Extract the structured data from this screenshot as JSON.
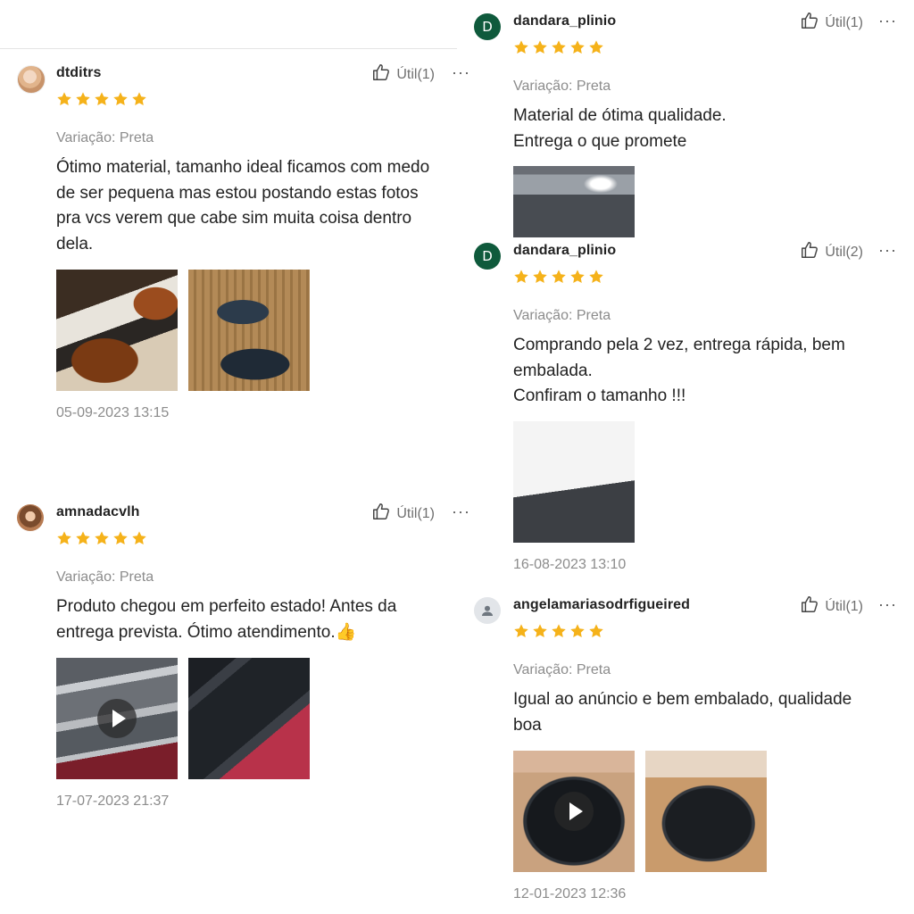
{
  "colors": {
    "star": "#f5b21a",
    "muted": "#8c8c8c",
    "avatar_d": "#0f5a3c"
  },
  "reviews": [
    {
      "username": "dtditrs",
      "avatar": "avatar-photo",
      "helpful": "Útil(1)",
      "rating": 5,
      "variation": "Variação: Preta",
      "text": "Ótimo material, tamanho ideal  ficamos com medo de ser pequena mas estou postando estas fotos pra vcs verem que cabe sim muita coisa dentro dela.",
      "photos": [
        "photo",
        "photo"
      ],
      "date": "05-09-2023 13:15"
    },
    {
      "username": "amnadacvlh",
      "avatar": "avatar-photo",
      "helpful": "Útil(1)",
      "rating": 5,
      "variation": "Variação: Preta",
      "text": "Produto chegou em perfeito estado! Antes da entrega prevista. Ótimo atendimento.👍",
      "photos": [
        "video",
        "photo"
      ],
      "date": "17-07-2023 21:37"
    },
    {
      "username": "dandara_plinio",
      "avatar_letter": "D",
      "helpful": "Útil(1)",
      "rating": 5,
      "variation": "Variação: Preta",
      "text_lines": [
        "Material de ótima qualidade.",
        "Entrega o que promete"
      ],
      "photos": [
        "photo"
      ]
    },
    {
      "username": "dandara_plinio",
      "avatar_letter": "D",
      "helpful": "Útil(2)",
      "rating": 5,
      "variation": "Variação: Preta",
      "text_lines": [
        "Comprando pela 2 vez, entrega rápida, bem embalada.",
        "Confiram o tamanho !!!"
      ],
      "photos": [
        "photo"
      ],
      "date": "16-08-2023 13:10"
    },
    {
      "username": "angelamariasodrfigueired",
      "avatar": "person-icon",
      "helpful": "Útil(1)",
      "rating": 5,
      "variation": "Variação: Preta",
      "text": "Igual ao anúncio e bem embalado, qualidade boa",
      "photos": [
        "video",
        "photo"
      ],
      "date": "12-01-2023 12:36"
    }
  ],
  "more_label": "···"
}
